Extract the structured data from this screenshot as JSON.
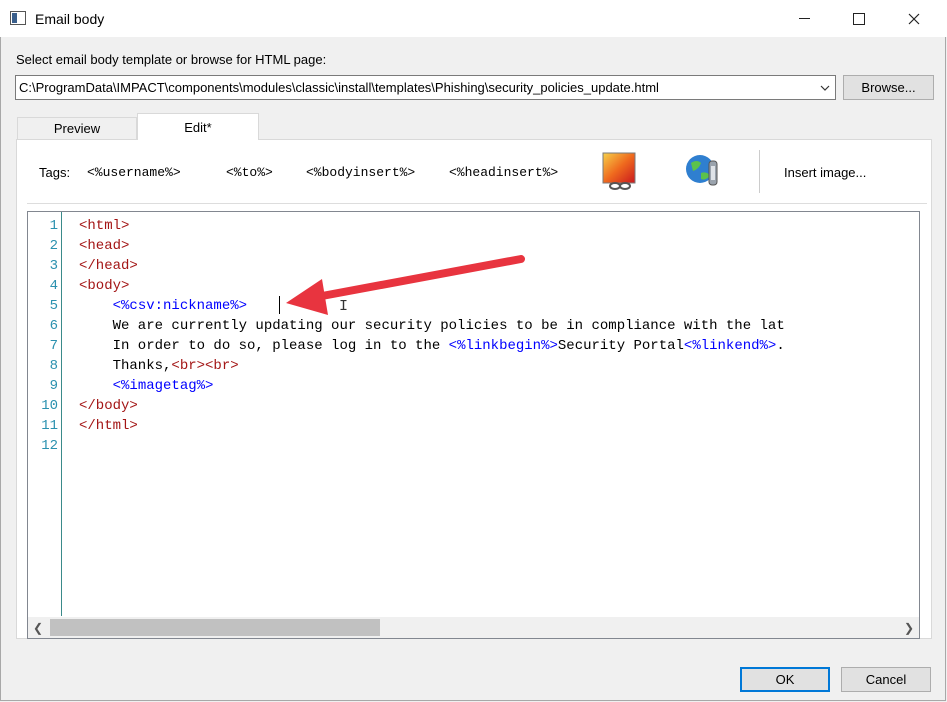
{
  "window": {
    "title": "Email body",
    "minimize_icon": "minimize-icon",
    "maximize_icon": "maximize-icon",
    "close_icon": "close-icon"
  },
  "template": {
    "label": "Select email body template or browse for HTML page:",
    "path": "C:\\ProgramData\\IMPACT\\components\\modules\\classic\\install\\templates\\Phishing\\security_policies_update.html",
    "browse_label": "Browse..."
  },
  "tabs": [
    {
      "label": "Preview",
      "active": false
    },
    {
      "label": "Edit*",
      "active": true
    }
  ],
  "toolbar": {
    "tags_label": "Tags:",
    "tags": [
      "<%username%>",
      "<%to%>",
      "<%bodyinsert%>",
      "<%headinsert%>"
    ],
    "image_link_icon": "image-link-icon",
    "globe_link_icon": "globe-link-icon",
    "insert_image_label": "Insert image..."
  },
  "editor": {
    "line_numbers": [
      "1",
      "2",
      "3",
      "4",
      "5",
      "6",
      "7",
      "8",
      "9",
      "10",
      "11",
      "12"
    ],
    "lines": [
      [
        {
          "t": "<html>",
          "c": "tagc"
        }
      ],
      [
        {
          "t": "<head>",
          "c": "tagc"
        }
      ],
      [
        {
          "t": "</head>",
          "c": "tagc"
        }
      ],
      [
        {
          "t": "<body>",
          "c": "tagc"
        }
      ],
      [
        {
          "t": "    ",
          "c": ""
        },
        {
          "t": "<%csv:nickname%>",
          "c": "pct"
        }
      ],
      [
        {
          "t": "    We are currently updating our security policies to be in compliance with the lat",
          "c": ""
        }
      ],
      [
        {
          "t": "    In order to do so, please log in to the ",
          "c": ""
        },
        {
          "t": "<%linkbegin%>",
          "c": "pct"
        },
        {
          "t": "Security Portal",
          "c": ""
        },
        {
          "t": "<%linkend%>",
          "c": "pct"
        },
        {
          "t": ".",
          "c": ""
        }
      ],
      [
        {
          "t": "    Thanks,",
          "c": ""
        },
        {
          "t": "<br><br>",
          "c": "tagc"
        }
      ],
      [
        {
          "t": "    ",
          "c": ""
        },
        {
          "t": "<%imagetag%>",
          "c": "pct"
        }
      ],
      [
        {
          "t": "</body>",
          "c": "tagc"
        }
      ],
      [
        {
          "t": "</html>",
          "c": "tagc"
        }
      ],
      []
    ]
  },
  "buttons": {
    "ok": "OK",
    "cancel": "Cancel"
  },
  "colors": {
    "tag": "#a31515",
    "placeholder": "#0000ff",
    "line_number": "#2b91af",
    "annotation_arrow": "#e8343f",
    "default_button_border": "#0078d7"
  }
}
